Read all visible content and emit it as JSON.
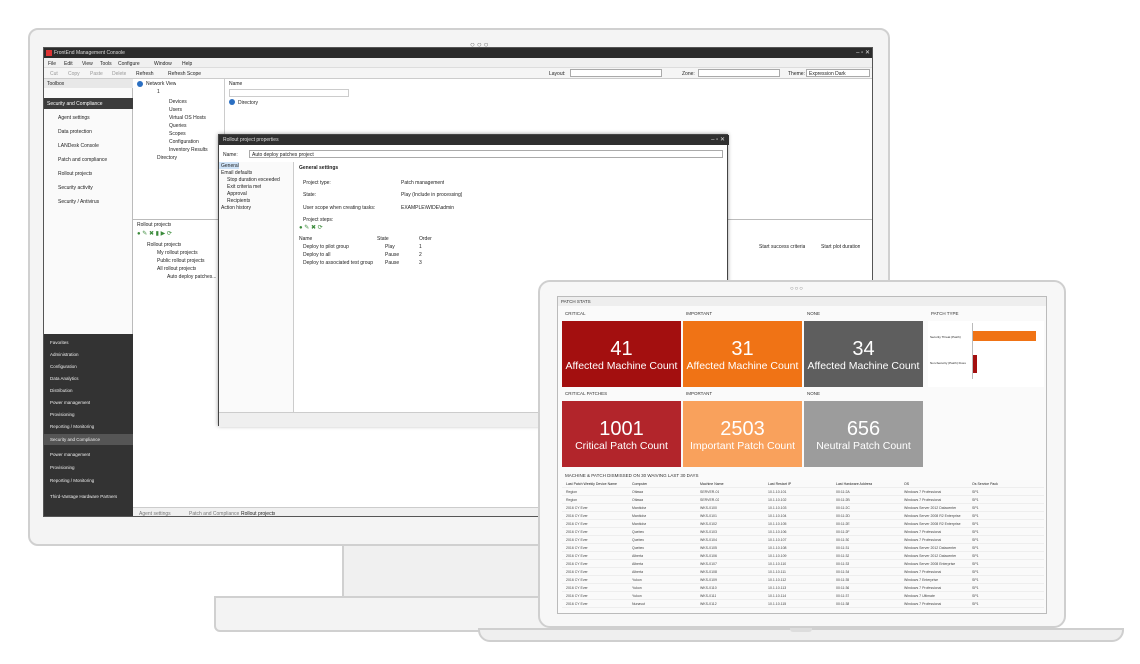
{
  "app": {
    "title": "FrontEnd Management Console",
    "menu": [
      "File",
      "Edit",
      "View",
      "Tools",
      "Configure",
      "Window",
      "Help"
    ],
    "toolbar": {
      "buttons": [
        "Cut",
        "Copy",
        "Paste",
        "Delete",
        "Refresh",
        "Refresh Scope"
      ],
      "layout_label": "Layout:",
      "zone_label": "Zone:",
      "theme_label": "Theme:",
      "theme_value": "Expression Dark"
    },
    "toolbox": {
      "title": "Toolbox",
      "section": "Security and Compliance",
      "items": [
        "Agent settings",
        "Data protection",
        "LANDesk Console",
        "Patch and compliance",
        "Rollout projects",
        "Security activity",
        "Security / Antivirus"
      ],
      "dark_items": [
        "Favorites",
        "Administration",
        "Configuration",
        "Data Analytics",
        "Distribution",
        "Power management",
        "Provisioning",
        "Reporting / Monitoring",
        "Security and Compliance",
        "Power management",
        "Provisioning",
        "Reporting / Monitoring",
        "Third-Vantage Hardware Partners"
      ]
    },
    "network_view": {
      "title": "Network View",
      "root": "1",
      "nodes": [
        "Devices",
        "Users",
        "Virtual OS Hosts",
        "Queries",
        "Scopes",
        "Configuration",
        "Inventory Results",
        "Directory"
      ]
    },
    "right_pane": {
      "header": "Name",
      "items": [
        "Directory"
      ]
    },
    "rollout": {
      "title": "Rollout projects",
      "tree": [
        "Rollout projects",
        "My rollout projects",
        "Public rollout projects",
        "All rollout projects",
        "Auto deploy patches..."
      ],
      "col1": "Start success criteria",
      "col2": "Start plot duration"
    },
    "dialog": {
      "title": "Rollout project properties",
      "name_label": "Name:",
      "name_value": "Auto deploy patches project",
      "left_items": [
        "General",
        "Email defaults",
        "Stop duration exceeded",
        "Exit criteria met",
        "Approval",
        "Recipients",
        "Action history"
      ],
      "section": "General settings",
      "project_type_label": "Project type:",
      "project_type_value": "Patch management",
      "state_label": "State:",
      "state_value": "Play (Include in processing)",
      "scope_label": "User scope when creating tasks:",
      "scope_value": "EXAMPLE\\WIDE\\admin",
      "steps_label": "Project steps:",
      "steps_headers": [
        "Name",
        "State",
        "Order"
      ],
      "steps": [
        {
          "name": "Deploy to pilot group",
          "state": "Play",
          "order": "1"
        },
        {
          "name": "Deploy to all",
          "state": "Pause",
          "order": "2"
        },
        {
          "name": "Deploy to associated test group",
          "state": "Pause",
          "order": "3"
        }
      ]
    },
    "status_tabs": [
      "Agent settings",
      "Patch and Compliance",
      "Rollout projects"
    ]
  },
  "dashboard": {
    "title": "PATCH STATS",
    "tiles": [
      {
        "header": "CRITICAL",
        "number": "41",
        "label": "Affected Machine Count",
        "color": "#a30f0f"
      },
      {
        "header": "IMPORTANT",
        "number": "31",
        "label": "Affected Machine Count",
        "color": "#f07315"
      },
      {
        "header": "NONE",
        "number": "34",
        "label": "Affected Machine Count",
        "color": "#5e5e5e"
      },
      {
        "header": "CRITICAL PATCHES",
        "number": "1001",
        "label": "Critical Patch Count",
        "color": "#b2252b"
      },
      {
        "header": "IMPORTANT",
        "number": "2503",
        "label": "Important Patch Count",
        "color": "#f9a15c"
      },
      {
        "header": "NONE",
        "number": "656",
        "label": "Neutral Patch Count",
        "color": "#9c9c9c"
      }
    ],
    "patch_type": {
      "header": "PATCH TYPE",
      "bar1_label": "Security Threat (Patch)",
      "bar2_label": "Non-Security (Patch) Fixes",
      "bar1_color": "#f07315",
      "bar2_color": "#a30f0f",
      "bar1_fraction": 0.92,
      "bar2_fraction": 0.06
    },
    "table": {
      "title": "MACHINE & PATCH DISMISSED ON 30 WAIVING LAST 30 DAYS",
      "headers": [
        "Last Patch Weekly Device Name",
        "Computer",
        "Machine Name",
        "Last Restart IP",
        "Last Hardware Address",
        "OS",
        "Os Service Pack"
      ],
      "rows": [
        [
          "Region",
          "Ottawa",
          "SERVER-01",
          "10.1.10.101",
          "00:11:2A",
          "Windows 7 Professional",
          "SP1"
        ],
        [
          "Region",
          "Ottawa",
          "SERVER-02",
          "10.1.10.102",
          "00:11:2B",
          "Windows 7 Professional",
          "SP1"
        ],
        [
          "2016 CY Ever",
          "Manitoba",
          "WKS-0100",
          "10.1.10.103",
          "00:11:2C",
          "Windows Server 2012 Datacenter",
          "SP1"
        ],
        [
          "2016 CY Ever",
          "Manitoba",
          "WKS-0101",
          "10.1.10.104",
          "00:11:2D",
          "Windows Server 2008 R2 Enterprise",
          "SP1"
        ],
        [
          "2016 CY Ever",
          "Manitoba",
          "WKS-0102",
          "10.1.10.105",
          "00:11:2E",
          "Windows Server 2008 R2 Enterprise",
          "SP1"
        ],
        [
          "2016 CY Ever",
          "Quebec",
          "WKS-0103",
          "10.1.10.106",
          "00:11:2F",
          "Windows 7 Professional",
          "SP1"
        ],
        [
          "2016 CY Ever",
          "Quebec",
          "WKS-0104",
          "10.1.10.107",
          "00:11:30",
          "Windows 7 Professional",
          "SP1"
        ],
        [
          "2016 CY Ever",
          "Quebec",
          "WKS-0105",
          "10.1.10.108",
          "00:11:31",
          "Windows Server 2012 Datacenter",
          "SP1"
        ],
        [
          "2016 CY Ever",
          "Alberta",
          "WKS-0106",
          "10.1.10.109",
          "00:11:32",
          "Windows Server 2012 Datacenter",
          "SP1"
        ],
        [
          "2016 CY Ever",
          "Alberta",
          "WKS-0107",
          "10.1.10.110",
          "00:11:33",
          "Windows Server 2008 Enterprise",
          "SP1"
        ],
        [
          "2016 CY Ever",
          "Alberta",
          "WKS-0108",
          "10.1.10.111",
          "00:11:34",
          "Windows 7 Professional",
          "SP1"
        ],
        [
          "2016 CY Ever",
          "Yukon",
          "WKS-0109",
          "10.1.10.112",
          "00:11:35",
          "Windows 7 Enterprise",
          "SP1"
        ],
        [
          "2016 CY Ever",
          "Yukon",
          "WKS-0110",
          "10.1.10.113",
          "00:11:36",
          "Windows 7 Professional",
          "SP1"
        ],
        [
          "2016 CY Ever",
          "Yukon",
          "WKS-0111",
          "10.1.10.114",
          "00:11:37",
          "Windows 7 Ultimate",
          "SP1"
        ],
        [
          "2016 CY Ever",
          "Nunavut",
          "WKS-0112",
          "10.1.10.115",
          "00:11:38",
          "Windows 7 Professional",
          "SP1"
        ]
      ]
    }
  }
}
